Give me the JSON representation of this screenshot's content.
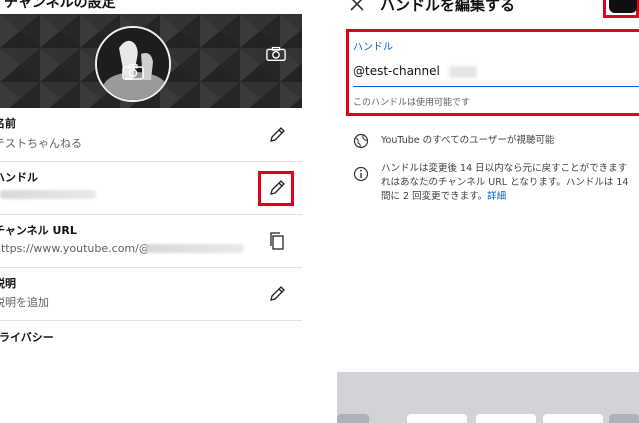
{
  "left": {
    "topbar_title": "チャンネルの設定",
    "rows": [
      {
        "title": "名前",
        "subtitle": "テストちゃんねる",
        "action_icon": "pencil-icon"
      },
      {
        "title": "ハンドル",
        "subtitle": "",
        "action_icon": "pencil-icon"
      },
      {
        "title": "チャンネル URL",
        "subtitle": "https://www.youtube.com/@",
        "action_icon": "copy-icon"
      },
      {
        "title": "説明",
        "subtitle": "説明を追加",
        "action_icon": "pencil-icon"
      },
      {
        "title": "プライバシー",
        "subtitle": "",
        "action_icon": ""
      }
    ]
  },
  "right": {
    "close_icon": "close-icon",
    "title": "ハンドルを編集する",
    "field": {
      "label": "ハンドル",
      "value": "@test-channel",
      "hint": "このハンドルは使用可能です"
    },
    "info1": {
      "icon": "globe-icon",
      "text": "YouTube のすべてのユーザーが視聴可能"
    },
    "info2": {
      "icon": "info-icon",
      "line1": "ハンドルは変更後 14 日以内なら元に戻すことができます",
      "line2": "れはあなたのチャンネル URL となります。ハンドルは 14",
      "line3_prefix": "間に 2 回変更できます。",
      "line3_link": "詳細"
    }
  },
  "colors": {
    "highlight": "#e1001a",
    "link": "#065fd4",
    "banner": "#2f2f2f"
  }
}
